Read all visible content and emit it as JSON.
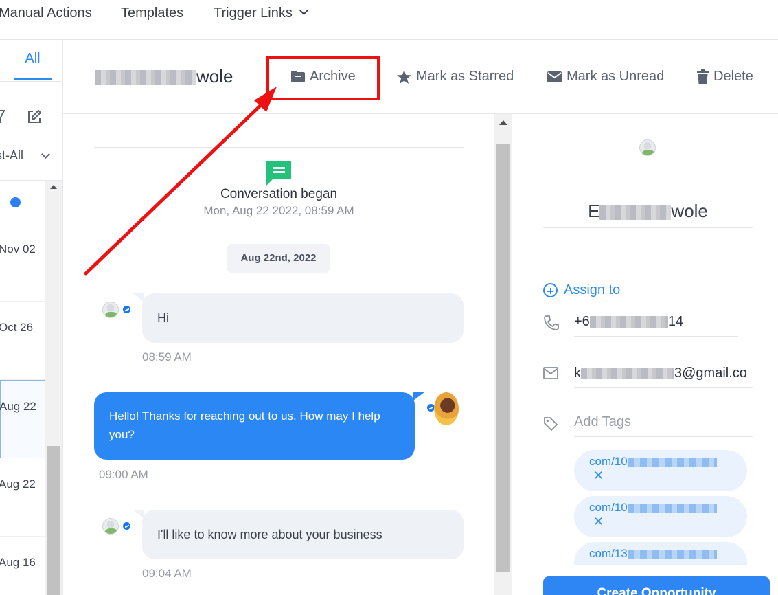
{
  "topnav": {
    "items": [
      "Manual Actions",
      "Templates",
      "Trigger Links"
    ]
  },
  "left": {
    "tab_all": "All",
    "status_filter": "st-All",
    "conversations": [
      {
        "date": "Nov 02"
      },
      {
        "date": "Oct 26"
      },
      {
        "date": "Aug 22"
      },
      {
        "date": "Aug 22"
      },
      {
        "date": "Aug 16"
      }
    ]
  },
  "header": {
    "contact_name_visible": "wole",
    "actions": {
      "archive": "Archive",
      "star": "Mark as Starred",
      "unread": "Mark as Unread",
      "delete": "Delete"
    }
  },
  "messages": {
    "began_title": "Conversation began",
    "began_date": "Mon, Aug 22 2022, 08:59 AM",
    "date_chip": "Aug 22nd, 2022",
    "items": [
      {
        "direction": "in",
        "text": "Hi",
        "time": "08:59 AM"
      },
      {
        "direction": "out",
        "text": "Hello! Thanks for reaching out to us. How may I help you?",
        "time": "09:00 AM"
      },
      {
        "direction": "in",
        "text": "I'll like to know more about your business",
        "time": "09:04 AM"
      }
    ]
  },
  "contact": {
    "name_start": "E",
    "name_end": "wole",
    "assign_label": "Assign to",
    "phone_start": "+6",
    "phone_end": "14",
    "email_start": "k",
    "email_end": "3@gmail.co",
    "add_tags_placeholder": "Add Tags",
    "tags": [
      {
        "prefix": "com/10"
      },
      {
        "prefix": "com/10"
      },
      {
        "prefix": "com/13"
      }
    ],
    "create_button": "Create Opportunity"
  },
  "colors": {
    "accent": "#2d8cf0",
    "outgoing_bubble": "#2b87f4",
    "incoming_bubble": "#eef1f6",
    "annotation_red": "#ee1111",
    "conversation_icon": "#22c27a"
  }
}
